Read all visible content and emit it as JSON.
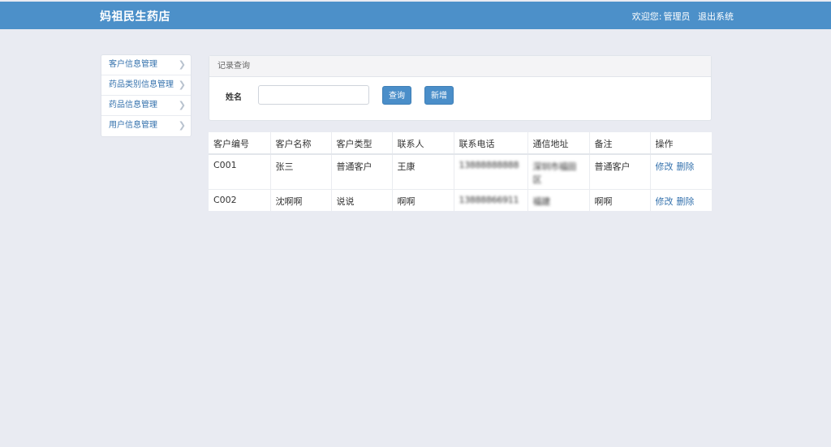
{
  "header": {
    "brand": "妈祖民生药店",
    "welcome": "欢迎您:",
    "username": "管理员",
    "logout": "退出系统"
  },
  "sidebar": {
    "items": [
      {
        "label": "客户信息管理"
      },
      {
        "label": "药品类别信息管理"
      },
      {
        "label": "药品信息管理"
      },
      {
        "label": "用户信息管理"
      }
    ]
  },
  "search": {
    "panel_title": "记录查询",
    "name_label": "姓名",
    "name_value": "",
    "search_button": "查询",
    "add_button": "新增"
  },
  "table": {
    "columns": [
      "客户编号",
      "客户名称",
      "客户类型",
      "联系人",
      "联系电话",
      "通信地址",
      "备注",
      "操作"
    ],
    "rows": [
      {
        "id": "C001",
        "name": "张三",
        "type": "普通客户",
        "contact": "王康",
        "phone": "13888888888",
        "address": "深圳市福田区",
        "note": "普通客户",
        "edit": "修改",
        "delete": "删除"
      },
      {
        "id": "C002",
        "name": "沈啊啊",
        "type": "说说",
        "contact": "啊啊",
        "phone": "13888866911",
        "address": "福建",
        "note": "啊啊",
        "edit": "修改",
        "delete": "删除"
      }
    ]
  }
}
